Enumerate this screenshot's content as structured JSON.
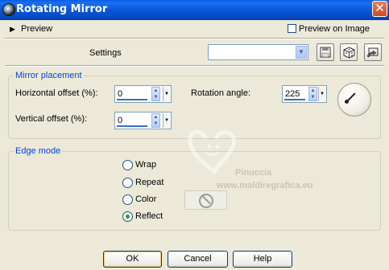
{
  "window": {
    "title": "Rotating Mirror",
    "close_glyph": "✕"
  },
  "preview": {
    "label": "Preview",
    "arrow": "▶",
    "on_image_label": "Preview on Image",
    "on_image_checked": false
  },
  "settings": {
    "label": "Settings",
    "value": ""
  },
  "toolbar": {
    "save_icon": "save-icon",
    "random_icon": "dice-icon",
    "reset_icon": "reset-icon"
  },
  "mirror_placement": {
    "title": "Mirror placement",
    "horizontal_offset_label": "Horizontal offset (%):",
    "horizontal_offset_value": "0",
    "vertical_offset_label": "Vertical offset (%):",
    "vertical_offset_value": "0",
    "rotation_angle_label": "Rotation angle:",
    "rotation_angle_value": "225"
  },
  "edge_mode": {
    "title": "Edge mode",
    "options": [
      {
        "label": "Wrap",
        "selected": false
      },
      {
        "label": "Repeat",
        "selected": false
      },
      {
        "label": "Color",
        "selected": false
      },
      {
        "label": "Reflect",
        "selected": true
      }
    ]
  },
  "watermark": {
    "line1": "Pinuccia",
    "line2": "www.maldiregrafica.eu"
  },
  "buttons": {
    "ok": "OK",
    "cancel": "Cancel",
    "help": "Help"
  },
  "colors": {
    "titlebar": "#0a56d8",
    "group_label": "#0046d5",
    "background": "#ece9d8",
    "radio_dot": "#21a121"
  }
}
